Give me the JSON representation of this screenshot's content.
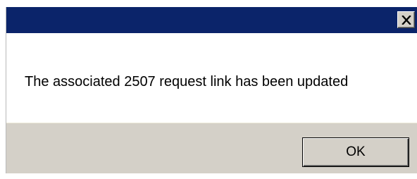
{
  "dialog": {
    "title": "",
    "message": "The associated 2507 request link has been updated",
    "ok_label": "OK",
    "close_icon": "close-icon",
    "colors": {
      "titlebar": "#0b246a",
      "button_area": "#d4d0c8",
      "message_background": "#ffffff"
    }
  }
}
